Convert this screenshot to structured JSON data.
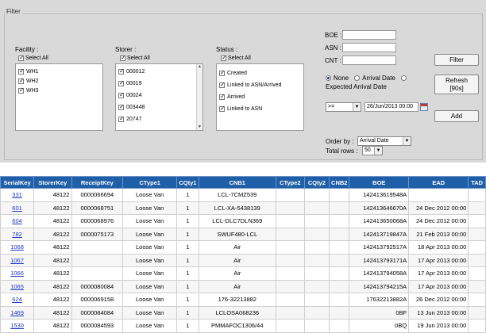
{
  "filter": {
    "legend": "Filter",
    "facility": {
      "label": "Facility :",
      "select_all": "Select All",
      "items": [
        "WH1",
        "WH2",
        "WH3"
      ]
    },
    "storer": {
      "label": "Storer :",
      "select_all": "Select All",
      "items": [
        "000012",
        "00019",
        "00024",
        "003448",
        "20747"
      ]
    },
    "status": {
      "label": "Status :",
      "select_all": "Select All",
      "items": [
        "Created",
        "Linked to ASN/Arrived",
        "Arrived",
        "Linked to ASN"
      ]
    },
    "boe_label": "BOE :",
    "asn_label": "ASN :",
    "cnt_label": "CNT :",
    "radio_none": "None",
    "radio_arrival": "Arrival Date",
    "radio_expected": "Expected Arrival Date",
    "operator_value": ">=",
    "date_value": "26/Jun/2013 00:00",
    "order_by_label": "Order by :",
    "order_by_value": "Arrival Date",
    "total_rows_label": "Total rows :",
    "total_rows_value": "50",
    "filter_button": "Filter",
    "refresh_button_line1": "Refresh",
    "refresh_button_line2": "[90s]",
    "add_button": "Add"
  },
  "table": {
    "columns": [
      "SerialKey",
      "StorerKey",
      "ReceiptKey",
      "CType1",
      "CQty1",
      "CNB1",
      "CType2",
      "CQty2",
      "CNB2",
      "BOE",
      "EAD",
      "TAD"
    ],
    "rows": [
      [
        "331",
        "48122",
        "0000066694",
        "Loose Van",
        "1",
        "LCL-7CMZ539",
        "",
        "",
        "",
        "142413619548A",
        "",
        ""
      ],
      [
        "601",
        "48122",
        "0000068751",
        "Loose Van",
        "1",
        "LCL-XA-5438139",
        "",
        "",
        "",
        "142413646670A",
        "24 Dec 2012 00:00",
        ""
      ],
      [
        "604",
        "48122",
        "0000068976",
        "Loose Van",
        "1",
        "LCL-DLC7DLN369",
        "",
        "",
        "",
        "142413650068A",
        "24 Dec 2012 00:00",
        ""
      ],
      [
        "782",
        "48122",
        "0000075173",
        "Loose Van",
        "1",
        "SWUF480-LCL",
        "",
        "",
        "",
        "142413719847A",
        "21 Feb 2013 00:00",
        ""
      ],
      [
        "1068",
        "48122",
        "",
        "Loose Van",
        "1",
        "Air",
        "",
        "",
        "",
        "142413792517A",
        "18 Apr 2013 00:00",
        ""
      ],
      [
        "1067",
        "48122",
        "",
        "Loose Van",
        "1",
        "Air",
        "",
        "",
        "",
        "142413793171A",
        "17 Apr 2013 00:00",
        ""
      ],
      [
        "1066",
        "48122",
        "",
        "Loose Van",
        "1",
        "Air",
        "",
        "",
        "",
        "142413794058A",
        "17 Apr 2013 00:00",
        ""
      ],
      [
        "1065",
        "48122",
        "0000080084",
        "Loose Van",
        "1",
        "Air",
        "",
        "",
        "",
        "142413794215A",
        "17 Apr 2013 00:00",
        ""
      ],
      [
        "624",
        "48122",
        "0000069158",
        "Loose Van",
        "1",
        "176-32213882",
        "",
        "",
        "",
        "17632213882A",
        "26 Dec 2012 00:00",
        ""
      ],
      [
        "1469",
        "48122",
        "0000084084",
        "Loose Van",
        "1",
        "LCLOSA068236",
        "",
        "",
        "",
        "0BF",
        "13 Jun 2013 00:00",
        ""
      ],
      [
        "1530",
        "48122",
        "0000084593",
        "Loose Van",
        "1",
        "PMMAFOC1306/44",
        "",
        "",
        "",
        "0BQ",
        "19 Jun 2013 00:00",
        ""
      ]
    ]
  }
}
